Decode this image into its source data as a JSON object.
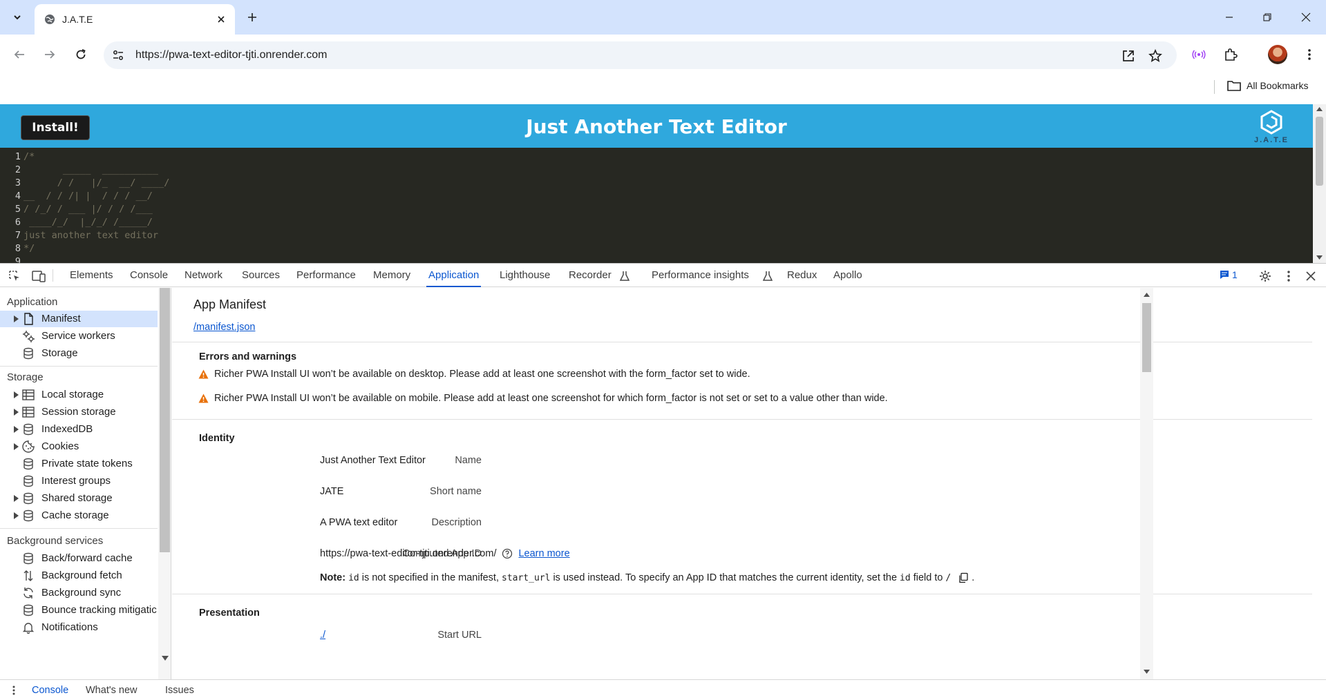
{
  "browser": {
    "tab_title": "J.A.T.E",
    "url": "https://pwa-text-editor-tjti.onrender.com",
    "all_bookmarks_label": "All Bookmarks"
  },
  "page": {
    "install_label": "Install!",
    "header_title": "Just Another Text Editor",
    "logo_text": "J.A.T.E",
    "code_lines": [
      {
        "num": "1",
        "text": "/*"
      },
      {
        "num": "2",
        "text": "       _____  __________"
      },
      {
        "num": "3",
        "text": "      / /   |/_  __/ ____/"
      },
      {
        "num": "4",
        "text": "__  / / /| |  / / / __/"
      },
      {
        "num": "5",
        "text": "/ /_/ / ___ |/ / / /___"
      },
      {
        "num": "6",
        "text": " ____/_/  |_/_/ /_____/"
      },
      {
        "num": "7",
        "text": "just another text editor"
      },
      {
        "num": "8",
        "text": "*/"
      },
      {
        "num": "9",
        "text": ""
      }
    ]
  },
  "devtools": {
    "tabs": [
      "Elements",
      "Console",
      "Network",
      "Sources",
      "Performance",
      "Memory",
      "Application",
      "Lighthouse",
      "Recorder",
      "Performance insights",
      "Redux",
      "Apollo"
    ],
    "active_tab": "Application",
    "message_count": "1",
    "sidebar": {
      "application_heading": "Application",
      "application_items": [
        "Manifest",
        "Service workers",
        "Storage"
      ],
      "storage_heading": "Storage",
      "storage_items": [
        "Local storage",
        "Session storage",
        "IndexedDB",
        "Cookies",
        "Private state tokens",
        "Interest groups",
        "Shared storage",
        "Cache storage"
      ],
      "background_heading": "Background services",
      "background_items": [
        "Back/forward cache",
        "Background fetch",
        "Background sync",
        "Bounce tracking mitigatic",
        "Notifications"
      ]
    },
    "manifest": {
      "title": "App Manifest",
      "link": "/manifest.json",
      "errors_heading": "Errors and warnings",
      "warnings": [
        "Richer PWA Install UI won’t be available on desktop. Please add at least one screenshot with the form_factor set to wide.",
        "Richer PWA Install UI won’t be available on mobile. Please add at least one screenshot for which form_factor is not set or set to a value other than wide."
      ],
      "identity_heading": "Identity",
      "name_label": "Name",
      "name_value": "Just Another Text Editor",
      "short_name_label": "Short name",
      "short_name_value": "JATE",
      "description_label": "Description",
      "description_value": "A PWA text editor",
      "app_id_label": "Computed App ID",
      "app_id_value": "https://pwa-text-editor-tjti.onrender.com/",
      "learn_more": "Learn more",
      "note_label": "Note:",
      "note_id": "id",
      "note_text1": "is not specified in the manifest,",
      "note_start_url": "start_url",
      "note_text2": "is used instead. To specify an App ID that matches the current identity, set the",
      "note_id2": "id",
      "note_text3": "field to",
      "note_slash": "/",
      "note_end": ".",
      "presentation_heading": "Presentation",
      "start_url_label": "Start URL",
      "start_url_value": "./"
    },
    "drawer_tabs": [
      "Console",
      "What's new",
      "Issues"
    ]
  }
}
